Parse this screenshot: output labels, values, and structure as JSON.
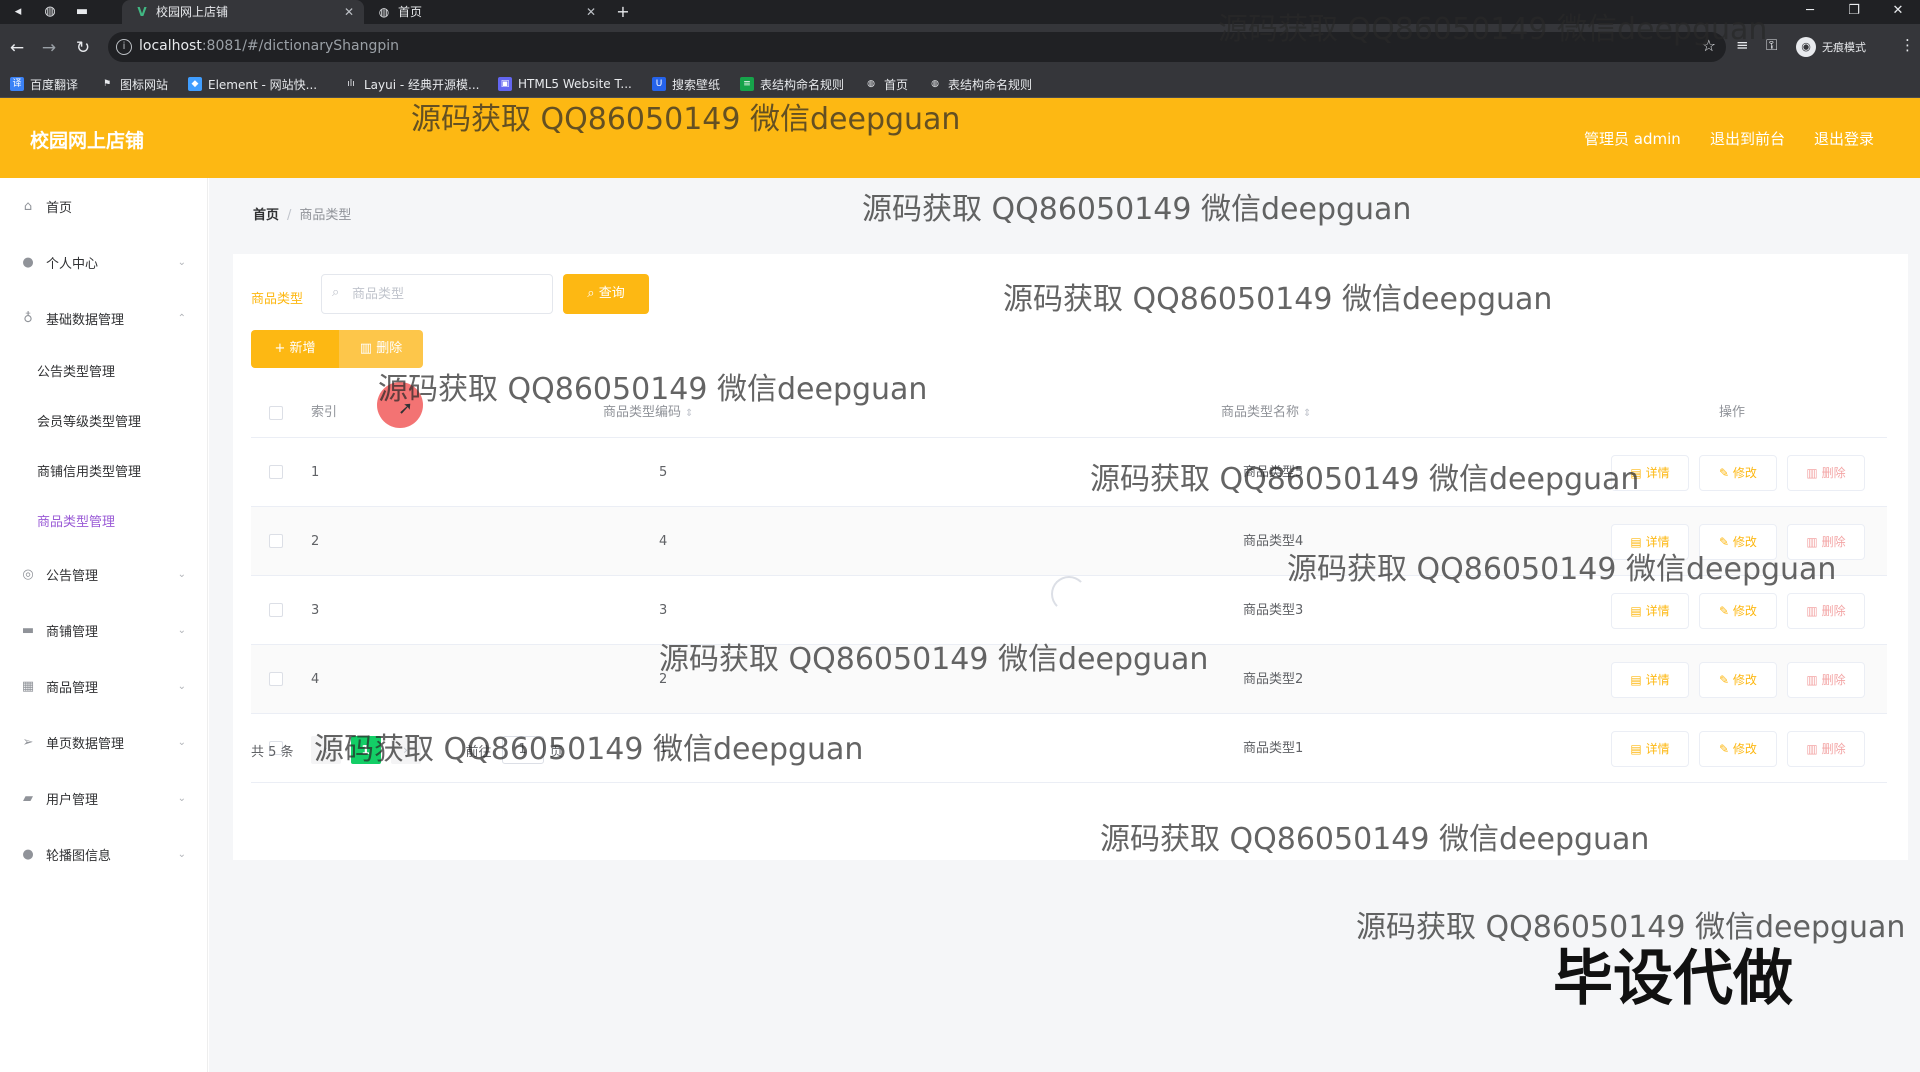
{
  "browser": {
    "tabs": [
      {
        "title": "校园网上店铺",
        "icon": "vue-icon",
        "active": true
      },
      {
        "title": "首页",
        "icon": "globe-icon",
        "active": false
      }
    ],
    "url_host": "localhost",
    "url_path": ":8081/#/dictionaryShangpin",
    "profile_label": "无痕模式",
    "bookmarks": [
      {
        "label": "百度翻译",
        "color": "#3b82f6"
      },
      {
        "label": "图标网站",
        "color": "#e8eaed"
      },
      {
        "label": "Element - 网站快...",
        "color": "#409eff"
      },
      {
        "label": "Layui - 经典开源模...",
        "color": "#e8eaed"
      },
      {
        "label": "HTML5 Website T...",
        "color": "#6366f1"
      },
      {
        "label": "搜索壁纸",
        "color": "#2563eb"
      },
      {
        "label": "表结构命名规则",
        "color": "#16a34a"
      },
      {
        "label": "首页",
        "color": "#e8eaed"
      },
      {
        "label": "表结构命名规则",
        "color": "#e8eaed"
      }
    ]
  },
  "header": {
    "title": "校园网上店铺",
    "admin_label": "管理员 admin",
    "front_link": "退出到前台",
    "logout_link": "退出登录",
    "accent_color": "#fdb813"
  },
  "sidebar": {
    "items": [
      {
        "label": "首页",
        "icon": "home-icon"
      },
      {
        "label": "个人中心",
        "icon": "user-icon"
      },
      {
        "label": "基础数据管理",
        "icon": "mic-icon"
      },
      {
        "label": "公告管理",
        "icon": "globe-icon"
      },
      {
        "label": "商铺管理",
        "icon": "chat-icon"
      },
      {
        "label": "商品管理",
        "icon": "grid-icon"
      },
      {
        "label": "单页数据管理",
        "icon": "send-icon"
      },
      {
        "label": "用户管理",
        "icon": "briefcase-icon"
      },
      {
        "label": "轮播图信息",
        "icon": "location-icon"
      }
    ],
    "subitems": [
      {
        "label": "公告类型管理"
      },
      {
        "label": "会员等级类型管理"
      },
      {
        "label": "商铺信用类型管理"
      },
      {
        "label": "商品类型管理",
        "active": true
      }
    ]
  },
  "breadcrumb": {
    "home": "首页",
    "current": "商品类型"
  },
  "search": {
    "label": "商品类型",
    "placeholder": "商品类型",
    "button": "查询"
  },
  "actions": {
    "add": "新增",
    "delete": "删除"
  },
  "table": {
    "columns": [
      "索引",
      "商品类型编码",
      "商品类型名称",
      "操作"
    ],
    "rows": [
      {
        "index": "1",
        "code": "5",
        "name": "商品类型5"
      },
      {
        "index": "2",
        "code": "4",
        "name": "商品类型4"
      },
      {
        "index": "3",
        "code": "3",
        "name": "商品类型3"
      },
      {
        "index": "4",
        "code": "2",
        "name": "商品类型2"
      },
      {
        "index": "5",
        "code": "1",
        "name": "商品类型1"
      }
    ],
    "row_actions": [
      "详情",
      "修改",
      "删除"
    ]
  },
  "pagination": {
    "total": "共 5 条",
    "current_page": "1",
    "goto_label": "前往",
    "goto_value": "1",
    "page_suffix": "页"
  },
  "watermark": {
    "text": "源码获取 QQ86050149 微信deepguan",
    "big_text": "毕设代做"
  }
}
